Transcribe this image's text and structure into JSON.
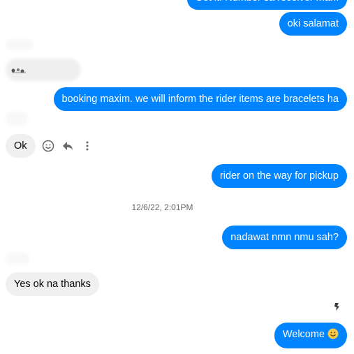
{
  "messages": {
    "top_partial": "Got it. Number sa receiver mam",
    "oki": "oki salamat",
    "booking": "booking maxim. we will inform the rider items are bracelets ha",
    "ok": "Ok",
    "rider": "rider on the way for pickup",
    "nadawat": "nadawat nmn nmu sah?",
    "yes": "Yes ok na thanks",
    "welcome": "Welcome"
  },
  "timestamp": "12/6/22, 2:01PM",
  "icons": {
    "react": "smiley-icon",
    "reply": "reply-icon",
    "more": "more-vertical-icon",
    "welcome_emoji": "smiley-emoji-icon"
  },
  "colors": {
    "outgoing_bubble": "#0084ff",
    "incoming_bubble": "#f0f0f0",
    "timestamp_text": "#65676b",
    "emoji": "#f7c948"
  }
}
